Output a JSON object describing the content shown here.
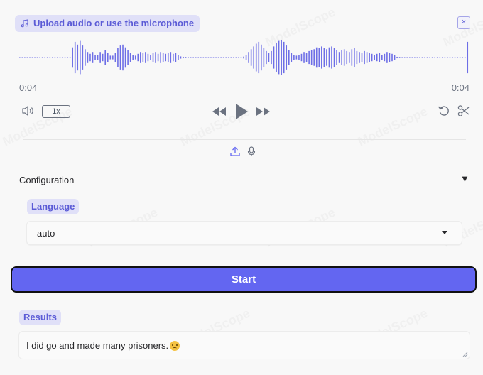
{
  "audio": {
    "upload_label": "Upload audio or use the microphone",
    "close_label": "×",
    "time_current": "0:04",
    "time_total": "0:04",
    "speed_label": "1x",
    "waveform": [
      0.02,
      0.02,
      0.02,
      0.02,
      0.02,
      0.02,
      0.02,
      0.02,
      0.02,
      0.02,
      0.02,
      0.02,
      0.02,
      0.02,
      0.02,
      0.02,
      0.02,
      0.02,
      0.02,
      0.02,
      0.02,
      0.55,
      0.85,
      0.7,
      0.9,
      0.65,
      0.45,
      0.3,
      0.2,
      0.3,
      0.15,
      0.15,
      0.3,
      0.2,
      0.4,
      0.25,
      0.1,
      0.1,
      0.25,
      0.5,
      0.65,
      0.7,
      0.55,
      0.4,
      0.25,
      0.15,
      0.1,
      0.2,
      0.3,
      0.25,
      0.3,
      0.2,
      0.15,
      0.25,
      0.3,
      0.2,
      0.3,
      0.25,
      0.2,
      0.25,
      0.3,
      0.2,
      0.25,
      0.15,
      0.06,
      0.04,
      0.03,
      0.02,
      0.02,
      0.02,
      0.02,
      0.02,
      0.02,
      0.02,
      0.02,
      0.02,
      0.02,
      0.02,
      0.02,
      0.02,
      0.02,
      0.02,
      0.02,
      0.02,
      0.02,
      0.02,
      0.02,
      0.02,
      0.02,
      0.05,
      0.15,
      0.3,
      0.45,
      0.6,
      0.75,
      0.85,
      0.7,
      0.5,
      0.35,
      0.25,
      0.35,
      0.6,
      0.78,
      0.9,
      0.95,
      0.85,
      0.65,
      0.4,
      0.25,
      0.15,
      0.1,
      0.12,
      0.2,
      0.3,
      0.25,
      0.35,
      0.4,
      0.45,
      0.55,
      0.5,
      0.6,
      0.5,
      0.45,
      0.55,
      0.6,
      0.5,
      0.4,
      0.3,
      0.4,
      0.45,
      0.35,
      0.3,
      0.45,
      0.5,
      0.35,
      0.3,
      0.25,
      0.35,
      0.3,
      0.25,
      0.2,
      0.15,
      0.2,
      0.25,
      0.15,
      0.2,
      0.3,
      0.25,
      0.2,
      0.15,
      0.04,
      0.03,
      0.02,
      0.02,
      0.02,
      0.02,
      0.02,
      0.02,
      0.02,
      0.02,
      0.02,
      0.02,
      0.02,
      0.02,
      0.02,
      0.02,
      0.02,
      0.02,
      0.02,
      0.02,
      0.02,
      0.02,
      0.02,
      0.02,
      0.02,
      0.02,
      0.02,
      0.02,
      0.85
    ]
  },
  "config": {
    "label": "Configuration",
    "toggle": "▼",
    "language_label": "Language",
    "language_value": "auto"
  },
  "start_label": "Start",
  "results": {
    "label": "Results",
    "text": "I did go and made many prisoners."
  },
  "colors": {
    "accent": "#6366f1",
    "label_bg": "#e0e0f8",
    "label_text": "#5b5bd6",
    "waveform": "#6d6ee6"
  },
  "watermark_text": "ModelScope"
}
